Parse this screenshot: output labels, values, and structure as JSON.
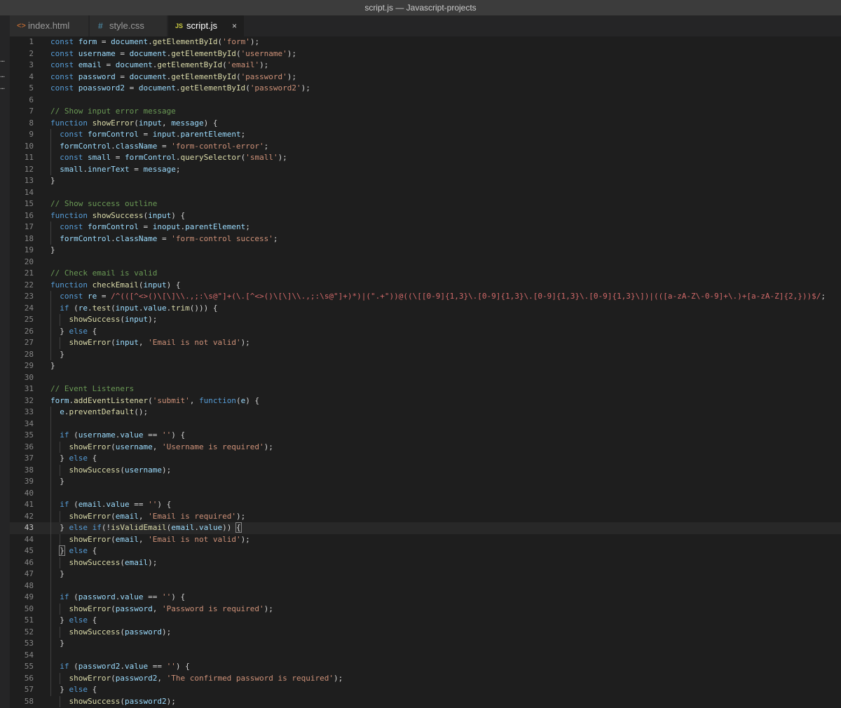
{
  "window": {
    "title": "script.js — Javascript-projects"
  },
  "tabs": [
    {
      "icon": "<>",
      "label": "index.html",
      "color": "#e37933"
    },
    {
      "icon": "#",
      "label": "style.css",
      "color": "#519aba"
    },
    {
      "icon": "JS",
      "label": "script.js",
      "color": "#cbcb41",
      "close": "×"
    }
  ],
  "sidebar": {
    "marks": [
      "...",
      "...",
      "..."
    ]
  },
  "editor": {
    "current_line": 43,
    "lines": [
      {
        "n": "1",
        "html": "<span class='k'>const</span> <span class='v'>form</span> = <span class='v'>document</span>.<span class='f'>getElementById</span>(<span class='s'>'form'</span>);"
      },
      {
        "n": "2",
        "html": "<span class='k'>const</span> <span class='v'>username</span> = <span class='v'>document</span>.<span class='f'>getElementById</span>(<span class='s'>'username'</span>);"
      },
      {
        "n": "3",
        "html": "<span class='k'>const</span> <span class='v'>email</span> = <span class='v'>document</span>.<span class='f'>getElementById</span>(<span class='s'>'email'</span>);"
      },
      {
        "n": "4",
        "html": "<span class='k'>const</span> <span class='v'>password</span> = <span class='v'>document</span>.<span class='f'>getElementById</span>(<span class='s'>'password'</span>);"
      },
      {
        "n": "5",
        "html": "<span class='k'>const</span> <span class='v'>poassword2</span> = <span class='v'>document</span>.<span class='f'>getElementById</span>(<span class='s'>'password2'</span>);"
      },
      {
        "n": "6",
        "html": ""
      },
      {
        "n": "7",
        "html": "<span class='c'>// Show input error message</span>"
      },
      {
        "n": "8",
        "html": "<span class='k'>function</span> <span class='f'>showError</span>(<span class='v'>input</span>, <span class='v'>message</span>) {"
      },
      {
        "n": "9",
        "html": "  <span class='k'>const</span> <span class='v'>formControl</span> = <span class='v'>input</span>.<span class='v'>parentElement</span>;"
      },
      {
        "n": "10",
        "html": "  <span class='v'>formControl</span>.<span class='v'>className</span> = <span class='s'>'form-control-error'</span>;"
      },
      {
        "n": "11",
        "html": "  <span class='k'>const</span> <span class='v'>small</span> = <span class='v'>formControl</span>.<span class='f'>querySelector</span>(<span class='s'>'small'</span>);"
      },
      {
        "n": "12",
        "html": "  <span class='v'>small</span>.<span class='v'>innerText</span> = <span class='v'>message</span>;"
      },
      {
        "n": "13",
        "html": "}"
      },
      {
        "n": "14",
        "html": ""
      },
      {
        "n": "15",
        "html": "<span class='c'>// Show success outline</span>"
      },
      {
        "n": "16",
        "html": "<span class='k'>function</span> <span class='f'>showSuccess</span>(<span class='v'>input</span>) {"
      },
      {
        "n": "17",
        "html": "  <span class='k'>const</span> <span class='v'>formControl</span> = <span class='v'>inoput</span>.<span class='v'>parentElement</span>;"
      },
      {
        "n": "18",
        "html": "  <span class='v'>formControl</span>.<span class='v'>className</span> = <span class='s'>'form-control success'</span>;"
      },
      {
        "n": "19",
        "html": "}"
      },
      {
        "n": "20",
        "html": ""
      },
      {
        "n": "21",
        "html": "<span class='c'>// Check email is valid</span>"
      },
      {
        "n": "22",
        "html": "<span class='k'>function</span> <span class='f'>checkEmail</span>(<span class='v'>input</span>) {"
      },
      {
        "n": "23",
        "html": "  <span class='k'>const</span> <span class='v'>re</span> = <span class='r'>/^(([^&lt;&gt;()\\[\\]\\\\.,;:\\s@\"]+(\\.[^&lt;&gt;()\\[\\]\\\\.,;:\\s@\"]+)*)|(\".+\"))@((\\[[0-9]{1,3}\\.[0-9]{1,3}\\.[0-9]{1,3}\\.[0-9]{1,3}\\])|(([a-zA-Z\\-0-9]+\\.)+[a-zA-Z]{2,}))$/</span>;"
      },
      {
        "n": "24",
        "html": "  <span class='k'>if</span> (<span class='v'>re</span>.<span class='f'>test</span>(<span class='v'>input</span>.<span class='v'>value</span>.<span class='f'>trim</span>())) {"
      },
      {
        "n": "25",
        "html": "    <span class='f'>showSuccess</span>(<span class='v'>input</span>);"
      },
      {
        "n": "26",
        "html": "  } <span class='k'>else</span> {"
      },
      {
        "n": "27",
        "html": "    <span class='f'>showError</span>(<span class='v'>input</span>, <span class='s'>'Email is not valid'</span>);"
      },
      {
        "n": "28",
        "html": "  }"
      },
      {
        "n": "29",
        "html": "}"
      },
      {
        "n": "30",
        "html": ""
      },
      {
        "n": "31",
        "html": "<span class='c'>// Event Listeners</span>"
      },
      {
        "n": "32",
        "html": "<span class='v'>form</span>.<span class='f'>addEventListener</span>(<span class='s'>'submit'</span>, <span class='k'>function</span>(<span class='v'>e</span>) {"
      },
      {
        "n": "33",
        "html": "  <span class='v'>e</span>.<span class='f'>preventDefault</span>();"
      },
      {
        "n": "34",
        "html": ""
      },
      {
        "n": "35",
        "html": "  <span class='k'>if</span> (<span class='v'>username</span>.<span class='v'>value</span> == <span class='s'>''</span>) {"
      },
      {
        "n": "36",
        "html": "    <span class='f'>showError</span>(<span class='v'>username</span>, <span class='s'>'Username is required'</span>);"
      },
      {
        "n": "37",
        "html": "  } <span class='k'>else</span> {"
      },
      {
        "n": "38",
        "html": "    <span class='f'>showSuccess</span>(<span class='v'>username</span>);"
      },
      {
        "n": "39",
        "html": "  }"
      },
      {
        "n": "40",
        "html": ""
      },
      {
        "n": "41",
        "html": "  <span class='k'>if</span> (<span class='v'>email</span>.<span class='v'>value</span> == <span class='s'>''</span>) {"
      },
      {
        "n": "42",
        "html": "    <span class='f'>showError</span>(<span class='v'>email</span>, <span class='s'>'Email is required'</span>);"
      },
      {
        "n": "43",
        "html": "  } <span class='k'>else</span> <span class='k'>if</span>(!<span class='f'>isValidEmail</span>(<span class='v'>email</span>.<span class='v'>value</span>)) <span class='bm'>{</span>"
      },
      {
        "n": "44",
        "html": "    <span class='f'>showError</span>(<span class='v'>email</span>, <span class='s'>'Email is not valid'</span>);"
      },
      {
        "n": "45",
        "html": "  <span class='bm'>}</span> <span class='k'>else</span> {"
      },
      {
        "n": "46",
        "html": "    <span class='f'>showSuccess</span>(<span class='v'>email</span>);"
      },
      {
        "n": "47",
        "html": "  }"
      },
      {
        "n": "48",
        "html": ""
      },
      {
        "n": "49",
        "html": "  <span class='k'>if</span> (<span class='v'>password</span>.<span class='v'>value</span> == <span class='s'>''</span>) {"
      },
      {
        "n": "50",
        "html": "    <span class='f'>showError</span>(<span class='v'>password</span>, <span class='s'>'Password is required'</span>);"
      },
      {
        "n": "51",
        "html": "  } <span class='k'>else</span> {"
      },
      {
        "n": "52",
        "html": "    <span class='f'>showSuccess</span>(<span class='v'>password</span>);"
      },
      {
        "n": "53",
        "html": "  }"
      },
      {
        "n": "54",
        "html": ""
      },
      {
        "n": "55",
        "html": "  <span class='k'>if</span> (<span class='v'>password2</span>.<span class='v'>value</span> == <span class='s'>''</span>) {"
      },
      {
        "n": "56",
        "html": "    <span class='f'>showError</span>(<span class='v'>password2</span>, <span class='s'>'The confirmed password is required'</span>);"
      },
      {
        "n": "57",
        "html": "  } <span class='k'>else</span> {"
      },
      {
        "n": "58",
        "html": "    <span class='f'>showSuccess</span>(<span class='v'>password2</span>);"
      }
    ]
  }
}
